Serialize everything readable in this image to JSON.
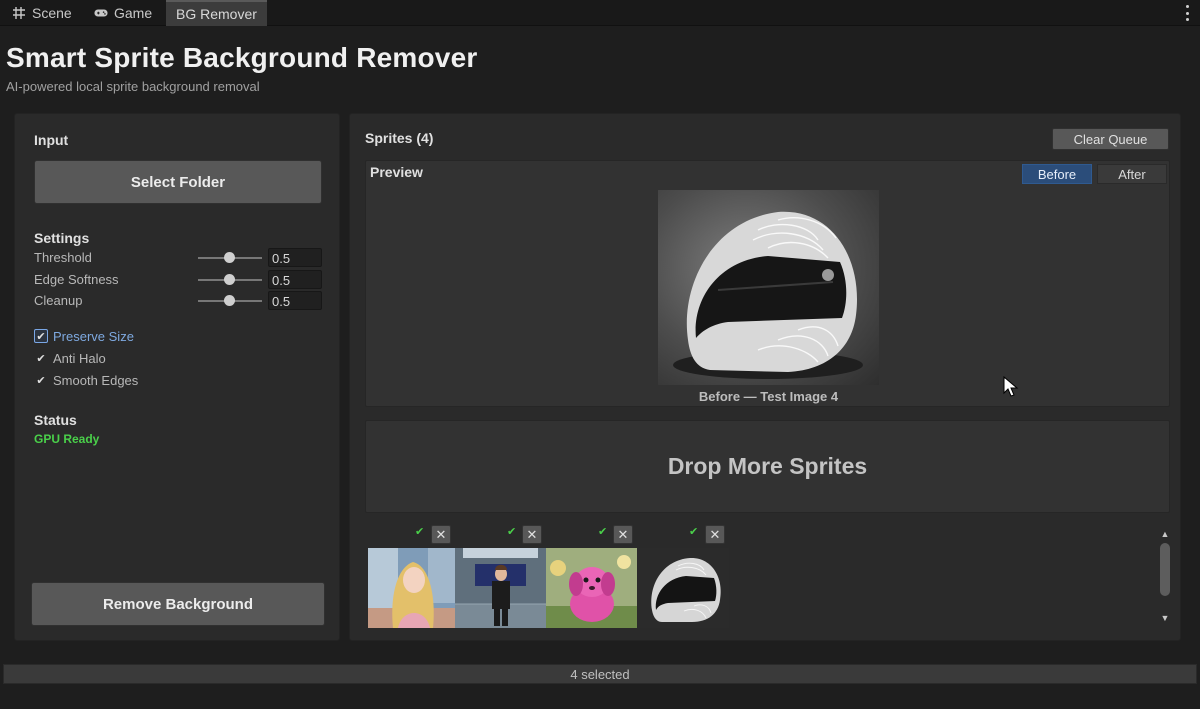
{
  "tabs": [
    {
      "label": "Scene",
      "icon": "grid-icon"
    },
    {
      "label": "Game",
      "icon": "gamepad-icon"
    },
    {
      "label": "BG Remover",
      "icon": ""
    }
  ],
  "header": {
    "title": "Smart Sprite Background Remover",
    "subtitle": "AI-powered local sprite background removal"
  },
  "left": {
    "input_label": "Input",
    "select_folder": "Select Folder",
    "settings_label": "Settings",
    "sliders": [
      {
        "label": "Threshold",
        "value": "0.5",
        "fraction": 0.5
      },
      {
        "label": "Edge Softness",
        "value": "0.5",
        "fraction": 0.5
      },
      {
        "label": "Cleanup",
        "value": "0.5",
        "fraction": 0.5
      }
    ],
    "checkboxes": [
      {
        "label": "Preserve Size",
        "checked": true
      },
      {
        "label": "Anti Halo",
        "checked": true
      },
      {
        "label": "Smooth Edges",
        "checked": true
      }
    ],
    "status_label": "Status",
    "status_value": "GPU Ready",
    "remove_button": "Remove Background"
  },
  "right": {
    "sprites_label": "Sprites (4)",
    "clear_queue": "Clear Queue",
    "preview_label": "Preview",
    "toggle_before": "Before",
    "toggle_after": "After",
    "preview_caption": "Before  —  Test Image 4",
    "drop_zone": "Drop More Sprites",
    "thumbnails": [
      {
        "name": "anime-girl-thumbnail",
        "done": true
      },
      {
        "name": "character-in-room-thumbnail",
        "done": true
      },
      {
        "name": "pink-puppy-thumbnail",
        "done": true
      },
      {
        "name": "helmet-thumbnail",
        "done": true
      }
    ],
    "close_glyph": "✕",
    "check_glyph": "✔"
  },
  "statusbar": {
    "text": "4 selected"
  },
  "colors": {
    "accent_blue": "#2b4d7a",
    "status_green": "#4ad04a",
    "focus_blue": "#7ea9e0"
  }
}
